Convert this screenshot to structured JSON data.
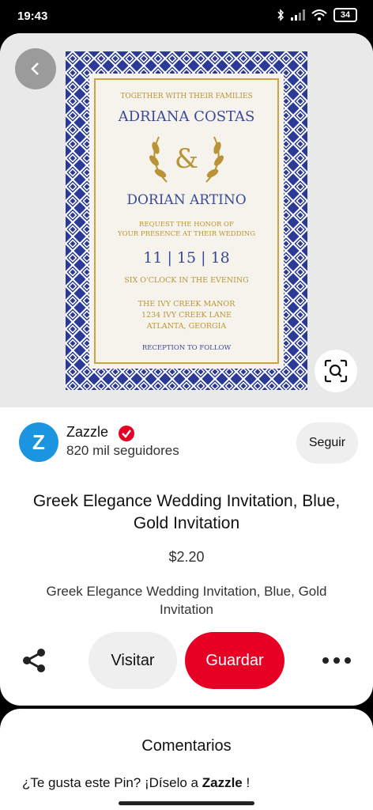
{
  "status_bar": {
    "time": "19:43",
    "battery": "34"
  },
  "invitation": {
    "line1": "TOGETHER WITH THEIR FAMILIES",
    "name1": "ADRIANA COSTAS",
    "ampersand": "&",
    "name2": "DORIAN ARTINO",
    "request1": "REQUEST THE HONOR OF",
    "request2": "YOUR PRESENCE AT THEIR WEDDING",
    "date": "11 | 15 | 18",
    "time": "SIX O'CLOCK IN THE EVENING",
    "venue1": "THE IVY CREEK MANOR",
    "venue2": "1234 IVY CREEK LANE",
    "venue3": "ATLANTA, GEORGIA",
    "reception": "RECEPTION TO FOLLOW",
    "colors": {
      "pattern": "#2b3a94",
      "gold": "#c9a447"
    }
  },
  "creator": {
    "avatar_letter": "Z",
    "name": "Zazzle",
    "followers": "820 mil seguidores",
    "follow_label": "Seguir"
  },
  "pin": {
    "title": "Greek Elegance Wedding Invitation, Blue, Gold Invitation",
    "price": "$2.20",
    "description": "Greek Elegance Wedding Invitation, Blue, Gold Invitation"
  },
  "actions": {
    "visit_label": "Visitar",
    "save_label": "Guardar"
  },
  "comments": {
    "title": "Comentarios",
    "prompt_prefix": "¿Te gusta este Pin? ¡Díselo a ",
    "prompt_name": "Zazzle",
    "prompt_suffix": " !"
  },
  "colors": {
    "accent": "#e60023",
    "avatar": "#1b95e0"
  }
}
